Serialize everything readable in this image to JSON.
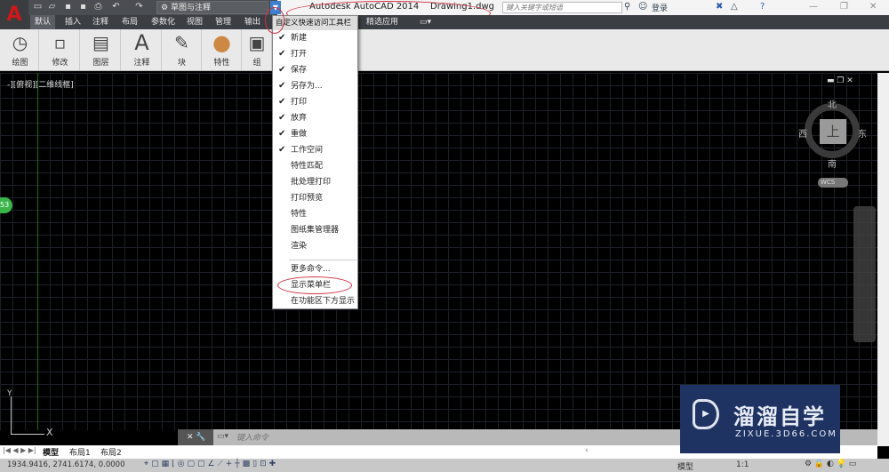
{
  "title": {
    "app": "Autodesk AutoCAD 2014",
    "file": "Drawing1.dwg",
    "search_placeholder": "键入关键字或短语",
    "login": "登录"
  },
  "workspace": "草图与注释",
  "tabs": [
    "默认",
    "插入",
    "注释",
    "布局",
    "参数化",
    "视图",
    "管理",
    "输出",
    "精选应用"
  ],
  "panels": [
    {
      "label": "绘图",
      "icon": "◷"
    },
    {
      "label": "修改",
      "icon": "▫"
    },
    {
      "label": "图层",
      "icon": "▤"
    },
    {
      "label": "注释",
      "icon": "A"
    },
    {
      "label": "块",
      "icon": "✎"
    },
    {
      "label": "特性",
      "icon": "●"
    },
    {
      "label": "组",
      "icon": "▣"
    }
  ],
  "viewport_label": "-][俯视][二维线框]",
  "menu": {
    "header": "自定义快速访问工具栏",
    "items": [
      {
        "label": "新建",
        "checked": true
      },
      {
        "label": "打开",
        "checked": true
      },
      {
        "label": "保存",
        "checked": true
      },
      {
        "label": "另存为...",
        "checked": true
      },
      {
        "label": "打印",
        "checked": true
      },
      {
        "label": "放弃",
        "checked": true
      },
      {
        "label": "重做",
        "checked": true
      },
      {
        "label": "工作空间",
        "checked": true
      },
      {
        "label": "特性匹配",
        "checked": false
      },
      {
        "label": "批处理打印",
        "checked": false
      },
      {
        "label": "打印预览",
        "checked": false
      },
      {
        "label": "特性",
        "checked": false
      },
      {
        "label": "图纸集管理器",
        "checked": false
      },
      {
        "label": "渲染",
        "checked": false
      }
    ],
    "more": "更多命令...",
    "show_menubar": "显示菜单栏",
    "below_ribbon": "在功能区下方显示"
  },
  "viewcube": {
    "north": "北",
    "south": "南",
    "east": "东",
    "west": "西",
    "face": "上",
    "wcs": "WCS"
  },
  "badge": "53",
  "command_placeholder": "键入命令",
  "layout_tabs": [
    "模型",
    "布局1",
    "布局2"
  ],
  "coords": "1934.9416, 2741.6174, 0.0000",
  "status_right": {
    "model": "模型",
    "scale": "1:1"
  },
  "watermark": {
    "name": "溜溜自学",
    "url": "ZIXUE.3D66.COM"
  },
  "colors": {
    "accent": "#3d7fd0",
    "annotation": "#d03040",
    "watermark_bg": "#1f3363"
  }
}
